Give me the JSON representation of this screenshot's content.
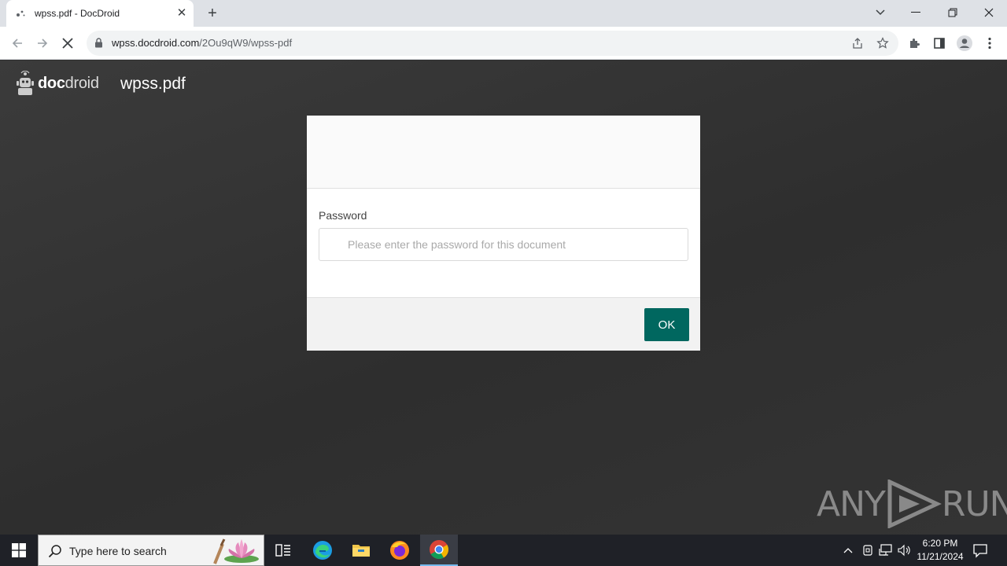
{
  "browser": {
    "tab_title": "wpss.pdf - DocDroid",
    "url_host": "wpss.docdroid.com",
    "url_path": "/2Ou9qW9/wpss-pdf"
  },
  "page": {
    "logo_bold": "doc",
    "logo_light": "droid",
    "document_title": "wpss.pdf"
  },
  "modal": {
    "password_label": "Password",
    "password_placeholder": "Please enter the password for this document",
    "password_value": "",
    "ok_label": "OK"
  },
  "watermark": {
    "left": "ANY",
    "right": "RUN"
  },
  "taskbar": {
    "search_placeholder": "Type here to search",
    "time": "6:20 PM",
    "date": "11/21/2024"
  },
  "colors": {
    "ok_button": "#00675f",
    "page_background": "#2f2f2f",
    "taskbar": "#1f2127"
  }
}
